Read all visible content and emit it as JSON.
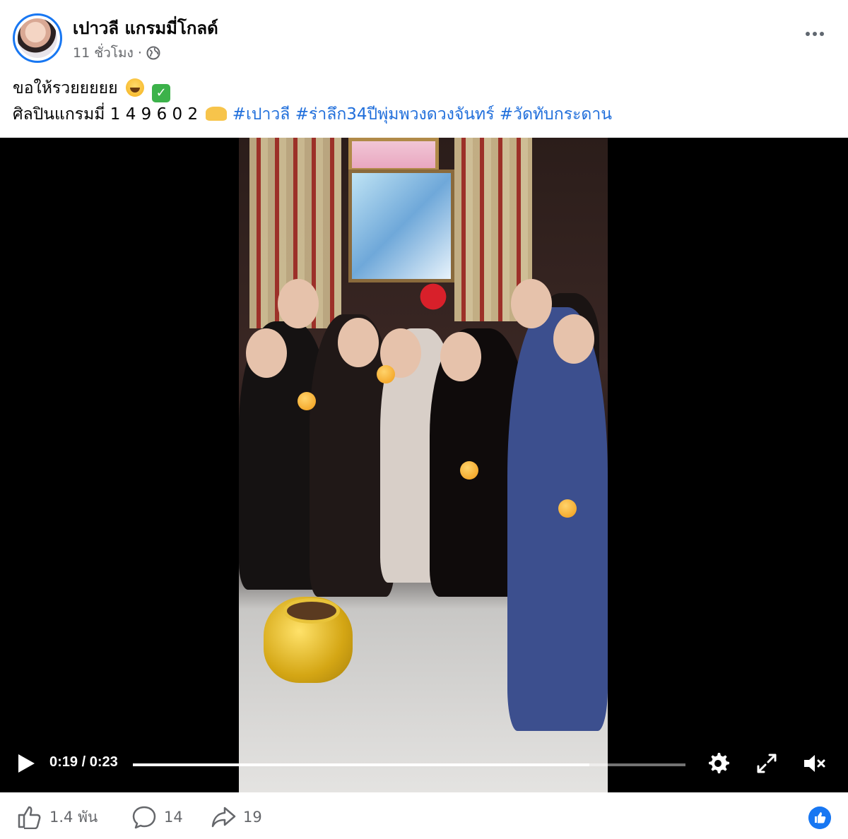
{
  "post": {
    "author": "เปาวลี แกรมมี่โกลด์",
    "time": "11 ชั่วโมง ·",
    "privacy_icon": "globe-icon",
    "more_icon": "more-icon"
  },
  "caption": {
    "line1": "ขอให้รวยยยยย",
    "line2_prefix": "ศิลปินแกรมมี่ 1 4 9 6 0 2",
    "hashtags": [
      "#เปาวลี",
      "#ร่าลึก34ปีพุ่มพวงดวงจันทร์",
      "#วัดทับกระดาน"
    ]
  },
  "video": {
    "time_display": "0:19 / 0:23",
    "progress": 0.826,
    "play_icon": "play-icon",
    "settings_icon": "gear-icon",
    "fullscreen_icon": "fullscreen-icon",
    "mute_icon": "muted-speaker-icon"
  },
  "actions": {
    "likes": "1.4 พัน",
    "comments": "14",
    "shares": "19"
  },
  "colors": {
    "accent": "#1877f2",
    "hashtag": "#216fdb",
    "secondary_text": "#65676b"
  }
}
